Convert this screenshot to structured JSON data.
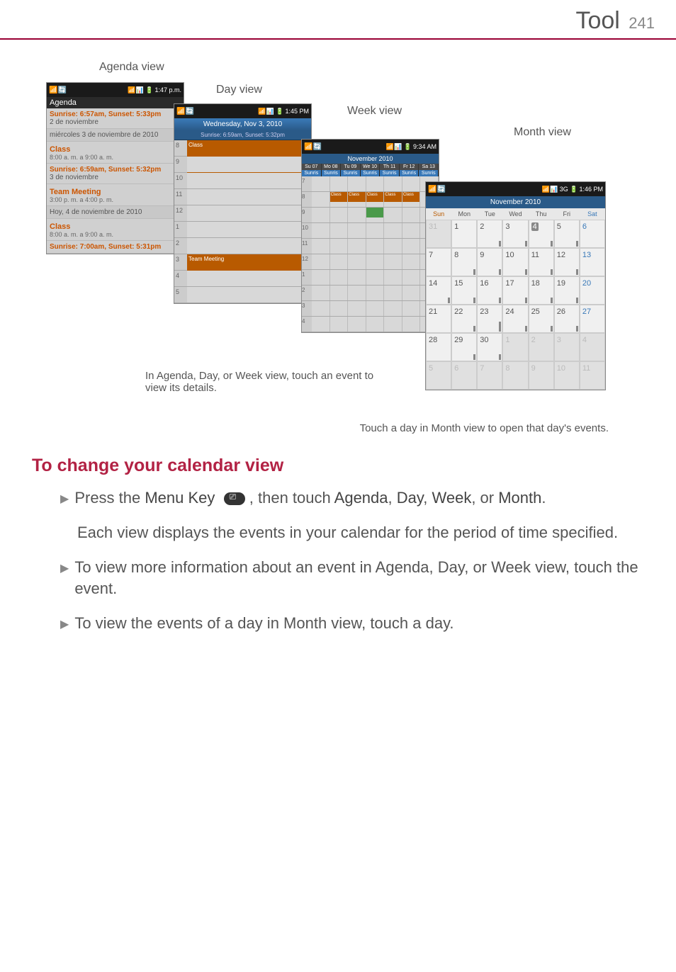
{
  "header": {
    "title": "Tool",
    "page_num": "241"
  },
  "labels": {
    "agenda": "Agenda view",
    "day": "Day view",
    "week": "Week view",
    "month": "Month view"
  },
  "agenda": {
    "bar_left": "📶",
    "bar_right_sig": "📶📊 🔋",
    "bar_time": "1:47 p.m.",
    "header": "Agenda",
    "row1_sun": "Sunrise: 6:57am, Sunset: 5:33pm",
    "row1_date": "2 de noviembre",
    "row2_title": "miércoles 3 de noviembre de 2010",
    "row3_title": "Class",
    "row3_time": "8:00 a. m. a 9:00 a. m.",
    "row4_sun": "Sunrise: 6:59am, Sunset: 5:32pm",
    "row4_date": "3 de noviembre",
    "row5_title": "Team Meeting",
    "row5_time": "3:00 p. m. a 4:00 p. m.",
    "row6_title": "Hoy, 4 de noviembre de 2010",
    "row7_title": "Class",
    "row7_time": "8:00 a. m. a 9:00 a. m.",
    "row8_sun": "Sunrise: 7:00am, Sunset: 5:31pm"
  },
  "day": {
    "bar_time": "1:45 PM",
    "date": "Wednesday, Nov 3, 2010",
    "sun": "Sunrise: 6:59am, Sunset: 5:32pm",
    "event1": "Class",
    "event2": "Team Meeting",
    "h8": "8",
    "h9": "9",
    "h10": "10",
    "h11": "11",
    "h12": "12",
    "h1": "1",
    "h2": "2",
    "h3": "3",
    "h4": "4",
    "h5": "5"
  },
  "week": {
    "bar_time": "9:34 AM",
    "head": "November 2010",
    "d1": "Su 07",
    "d2": "Mo 08",
    "d3": "Tu 09",
    "d4": "We 10",
    "d5": "Th 11",
    "d6": "Fr 12",
    "d7": "Sa 13",
    "sun": "Sunris",
    "ev": "Class",
    "h7": "7",
    "h8": "8",
    "h9": "9",
    "h10": "10",
    "h11": "11",
    "h12": "12",
    "h1": "1",
    "h2": "2",
    "h3": "3",
    "h4": "4"
  },
  "month": {
    "bar_time": "1:46 PM",
    "head": "November 2010",
    "dow": [
      "Sun",
      "Mon",
      "Tue",
      "Wed",
      "Thu",
      "Fri",
      "Sat"
    ],
    "weeks": [
      [
        "31",
        "1",
        "2",
        "3",
        "4",
        "5",
        "6"
      ],
      [
        "7",
        "8",
        "9",
        "10",
        "11",
        "12",
        "13"
      ],
      [
        "14",
        "15",
        "16",
        "17",
        "18",
        "19",
        "20"
      ],
      [
        "21",
        "22",
        "23",
        "24",
        "25",
        "26",
        "27"
      ],
      [
        "28",
        "29",
        "30",
        "1",
        "2",
        "3",
        "4"
      ],
      [
        "5",
        "6",
        "7",
        "8",
        "9",
        "10",
        "11"
      ]
    ]
  },
  "captions": {
    "c1": "In Agenda, Day, or Week view, touch an event to view its details.",
    "c2": "Touch a day in Month view to open that day's events."
  },
  "section": {
    "title": "To change your calendar view"
  },
  "body": {
    "b1_pre": "Press the ",
    "b1_menu": "Menu Key",
    "b1_mid": " , then touch ",
    "b1_a": "Agenda",
    "b1_c": ", ",
    "b1_d": "Day",
    "b1_w": "Week",
    "b1_or": ", or ",
    "b1_m": "Month",
    "b1_end": ".",
    "p1": "Each view displays the events in your calendar for the period of time specified.",
    "b2": "To view more information about an event in Agenda, Day, or Week view, touch the event.",
    "b3": "To view the events of a day in Month view, touch a day."
  }
}
